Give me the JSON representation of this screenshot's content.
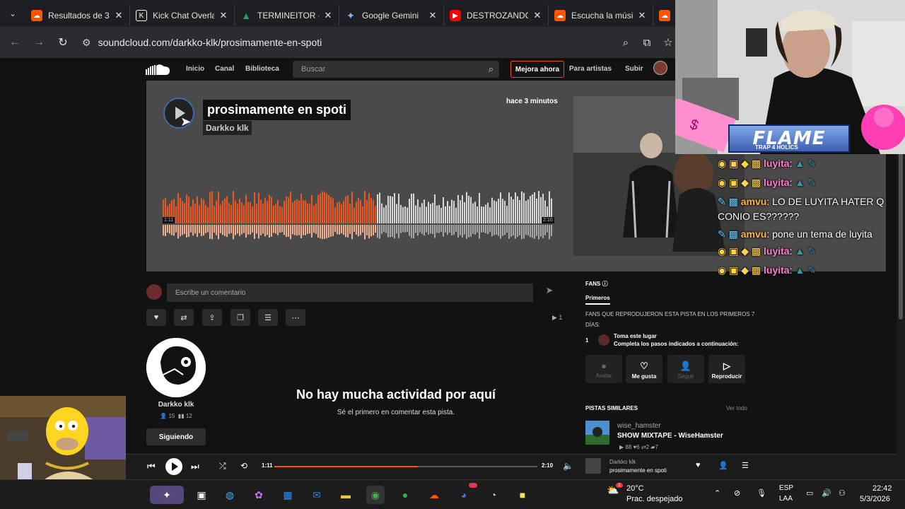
{
  "browser": {
    "tabs": [
      {
        "title": "Resultados de 3",
        "favicon": "soundcloud-icon",
        "color": "#ff5500"
      },
      {
        "title": "Kick Chat Overla",
        "favicon": "kick-icon",
        "color": "#ffffff"
      },
      {
        "title": "TERMINEITOR -",
        "favicon": "drive-icon",
        "color": "#1fa463"
      },
      {
        "title": "Google Gemini",
        "favicon": "gemini-icon",
        "color": "#6a7dfd"
      },
      {
        "title": "DESTROZANDO",
        "favicon": "youtube-icon",
        "color": "#ff0000"
      },
      {
        "title": "Escucha la músi",
        "favicon": "soundcloud-icon",
        "color": "#ff5500"
      }
    ],
    "url": "soundcloud.com/darkko-klk/prosimamente-en-spoti"
  },
  "soundcloud": {
    "nav": {
      "home": "Inicio",
      "feed": "Canal",
      "library": "Biblioteca"
    },
    "search_placeholder": "Buscar",
    "upgrade": "Mejora ahora",
    "for_artists": "Para artistas",
    "upload": "Subir"
  },
  "track": {
    "title": "prosimamente en spoti",
    "artist": "Darkko klk",
    "posted": "hace 3 minutos",
    "elapsed": "1:11",
    "duration": "2:10",
    "progress": 0.546
  },
  "comment": {
    "placeholder": "Escribe un comentario"
  },
  "stats": {
    "plays": "1"
  },
  "artist": {
    "name": "Darkko klk",
    "followers": "15",
    "tracks": "12",
    "follow_label": "Siguiendo"
  },
  "empty": {
    "title": "No hay mucha actividad por aquí",
    "subtitle": "Sé el primero en comentar esta pista."
  },
  "fans": {
    "heading": "FANS",
    "tab": "Primeros",
    "desc_line1": "FANS QUE REPRODUJERON ESTA PISTA EN LOS PRIMEROS 7",
    "desc_line2": "DÍAS:",
    "rank": "1",
    "slot_title": "Toma este lugar",
    "slot_sub": "Completa los pasos indicados a continuación:",
    "buttons": [
      "Avatar",
      "Me gusta",
      "Seguir",
      "Reproducir"
    ]
  },
  "similar": {
    "heading": "PISTAS SIMILARES",
    "view_all": "Ver todo",
    "user": "wise_hamster",
    "title": "SHOW MIXTAPE - WiseHamster",
    "plays": "88",
    "likes": "6",
    "reposts": "2",
    "comments": "7"
  },
  "player": {
    "elapsed": "1:11",
    "duration": "2:10",
    "artist": "Darkko klk",
    "title": "prosimamente en spoti"
  },
  "overlay": {
    "banner": "FLAME",
    "banner_sub": "TRAP 4 HOLICS",
    "chat": [
      {
        "user": "luyita",
        "msg": ""
      },
      {
        "user": "luyita",
        "msg": ""
      },
      {
        "user": "amvu",
        "msg": "LO DE LUYITA HATER Q CONIO ES??????"
      },
      {
        "user": "amvu",
        "msg": "pone un tema de luyita"
      },
      {
        "user": "luyita",
        "msg": ""
      },
      {
        "user": "luyita",
        "msg": ""
      }
    ]
  },
  "taskbar": {
    "temp": "20°C",
    "weather": "Prac. despejado",
    "lang1": "ESP",
    "lang2": "LAA",
    "time": "22:42",
    "date": "5/3/2026",
    "weather_badge": "1",
    "discord_badge": "9+"
  },
  "colors": {
    "accent": "#ff5500",
    "wave_played": "#f0561d",
    "wave_unplayed": "#d9d9d9"
  }
}
